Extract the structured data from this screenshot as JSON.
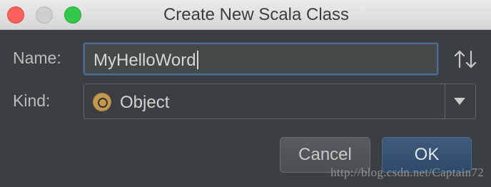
{
  "window": {
    "title": "Create New Scala Class"
  },
  "form": {
    "name_label": "Name:",
    "name_value": "MyHelloWord",
    "kind_label": "Kind:",
    "kind_value": "Object",
    "kind_icon": "object-icon"
  },
  "buttons": {
    "cancel": "Cancel",
    "ok": "OK"
  },
  "watermark": "http://blog.csdn.net/Captain72",
  "colors": {
    "background": "#3c3f41",
    "field_focus_border": "#4b6d90",
    "ok_button": "#365880",
    "object_icon": "#c29a4f"
  }
}
